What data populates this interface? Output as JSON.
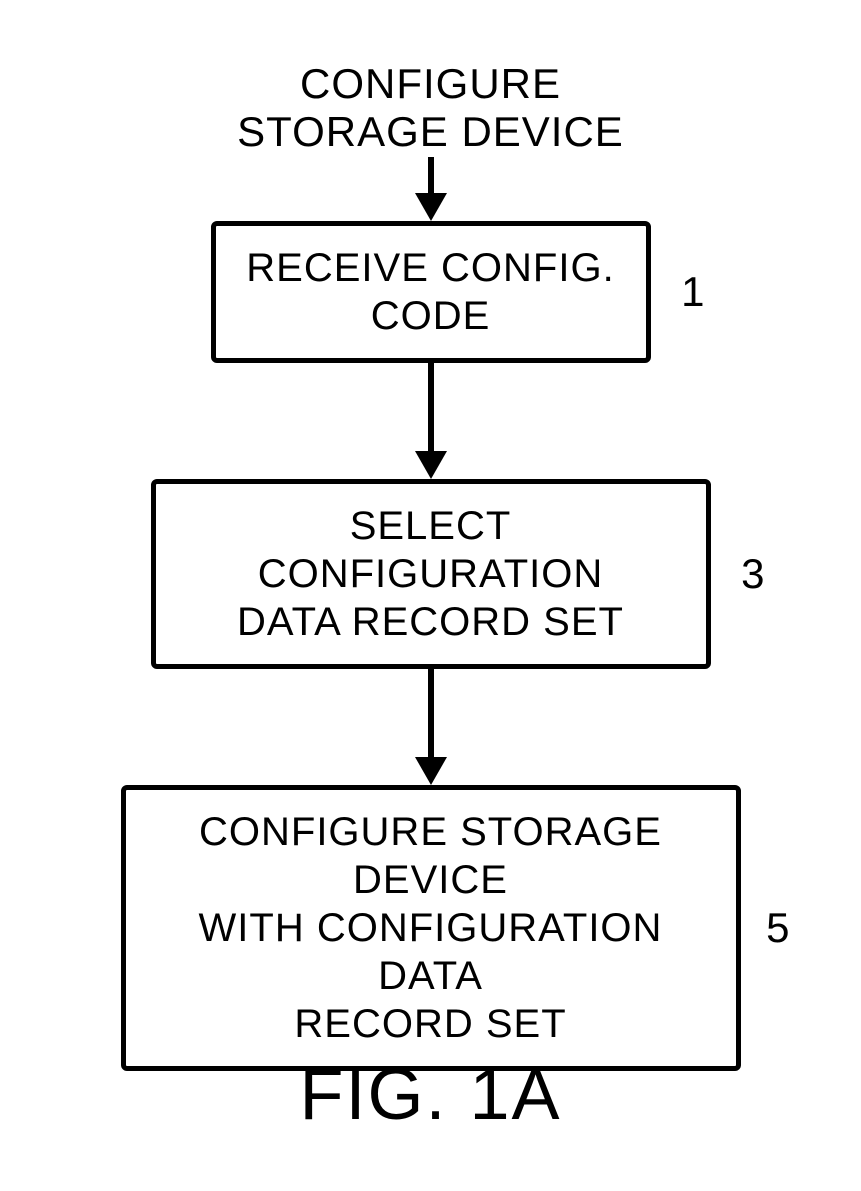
{
  "diagram": {
    "title_line1": "CONFIGURE",
    "title_line2": "STORAGE DEVICE",
    "steps": [
      {
        "text_line1": "RECEIVE CONFIG.",
        "text_line2": "CODE",
        "label": "1"
      },
      {
        "text_line1": "SELECT CONFIGURATION",
        "text_line2": "DATA RECORD SET",
        "label": "3"
      },
      {
        "text_line1": "CONFIGURE STORAGE DEVICE",
        "text_line2": "WITH CONFIGURATION DATA",
        "text_line3": "RECORD SET",
        "label": "5"
      }
    ],
    "figure_label": "FIG. 1A"
  }
}
